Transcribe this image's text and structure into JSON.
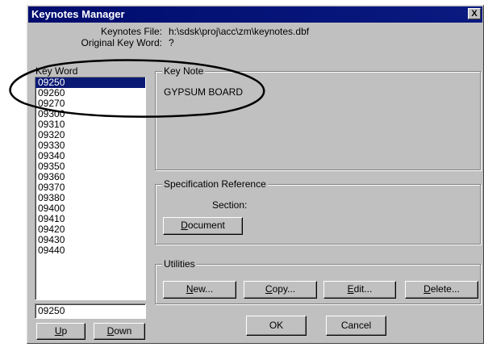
{
  "window": {
    "title": "Keynotes Manager",
    "close_label": "X"
  },
  "info": {
    "keynotes_file_label": "Keynotes File:",
    "keynotes_file_value": "h:\\sdsk\\proj\\acc\\zm\\keynotes.dbf",
    "original_keyword_label": "Original Key Word:",
    "original_keyword_value": "?"
  },
  "keyword": {
    "label": "Key Word",
    "items": [
      "09250",
      "09260",
      "09270",
      "09300",
      "09310",
      "09320",
      "09330",
      "09340",
      "09350",
      "09360",
      "09370",
      "09380",
      "09400",
      "09410",
      "09420",
      "09430",
      "09440"
    ],
    "selected_index": 0,
    "input_value": "09250",
    "up_label_u": "U",
    "up_label_rest": "p",
    "down_label_u": "D",
    "down_label_rest": "own"
  },
  "key_note": {
    "title": "Key Note",
    "text": "GYPSUM BOARD"
  },
  "spec": {
    "title": "Specification Reference",
    "section_label": "Section:",
    "document_u": "D",
    "document_rest": "ocument"
  },
  "utilities": {
    "title": "Utilities",
    "new_u": "N",
    "new_rest": "ew...",
    "copy_u": "C",
    "copy_rest": "opy...",
    "edit_u": "E",
    "edit_rest": "dit...",
    "delete_u": "D",
    "delete_rest": "elete..."
  },
  "footer": {
    "ok_label": "OK",
    "cancel_label": "Cancel"
  },
  "colors": {
    "titlebar": "#0a1a74",
    "selection": "#0a1a74",
    "dialog_face": "#c0c0c0"
  }
}
